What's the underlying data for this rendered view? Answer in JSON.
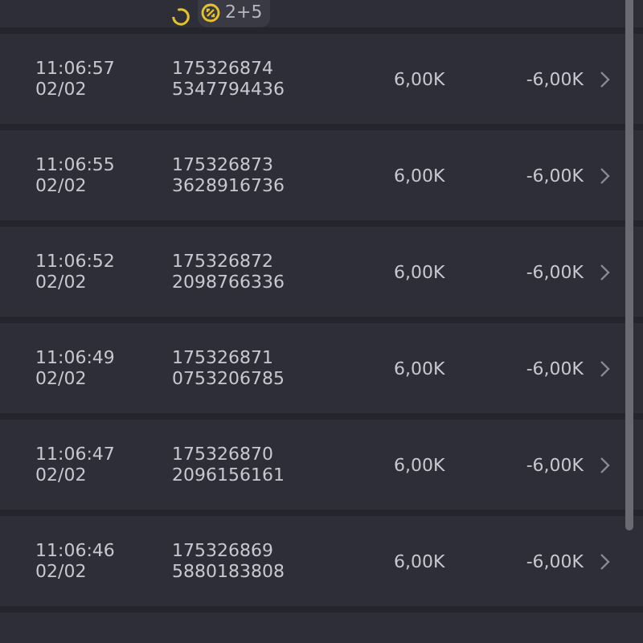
{
  "top_row": {
    "badge": "2+5"
  },
  "rows": [
    {
      "time": "11:06:57",
      "date": "02/02",
      "id": "175326874",
      "ref": "5347794436",
      "amount": "6,00K",
      "change": "-6,00K"
    },
    {
      "time": "11:06:55",
      "date": "02/02",
      "id": "175326873",
      "ref": "3628916736",
      "amount": "6,00K",
      "change": "-6,00K"
    },
    {
      "time": "11:06:52",
      "date": "02/02",
      "id": "175326872",
      "ref": "2098766336",
      "amount": "6,00K",
      "change": "-6,00K"
    },
    {
      "time": "11:06:49",
      "date": "02/02",
      "id": "175326871",
      "ref": "0753206785",
      "amount": "6,00K",
      "change": "-6,00K"
    },
    {
      "time": "11:06:47",
      "date": "02/02",
      "id": "175326870",
      "ref": "2096156161",
      "amount": "6,00K",
      "change": "-6,00K"
    },
    {
      "time": "11:06:46",
      "date": "02/02",
      "id": "175326869",
      "ref": "5880183808",
      "amount": "6,00K",
      "change": "-6,00K"
    }
  ]
}
